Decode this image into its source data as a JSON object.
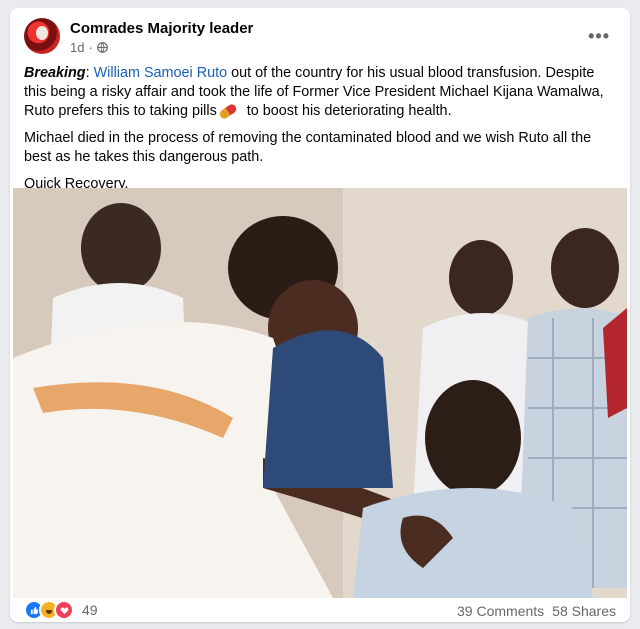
{
  "post": {
    "page_name": "Comrades Majority leader",
    "time": "1d",
    "more_label": "•••",
    "text": {
      "breaking": "Breaking",
      "colon": ": ",
      "link": "William Samoei Ruto",
      "para1_rest": " out of the country for his usual blood transfusion. Despite this being a risky affair and took the life of Former Vice President Michael Kijana Wamalwa, Ruto prefers this to taking pills",
      "para1_end": " to boost his deteriorating health.",
      "para2": "Michael died in the process of removing the contaminated blood and we wish Ruto all the best as he takes this dangerous path.",
      "para3": "Quick Recovery."
    },
    "reactions": {
      "count": "49",
      "icons": [
        "like-icon",
        "haha-icon",
        "love-icon"
      ]
    },
    "comments": "39 Comments",
    "shares": "58 Shares"
  },
  "colors": {
    "link": "#1a5fb4",
    "muted": "#65676b",
    "like": "#1877f2",
    "haha": "#f7b125",
    "love": "#f33e58"
  }
}
